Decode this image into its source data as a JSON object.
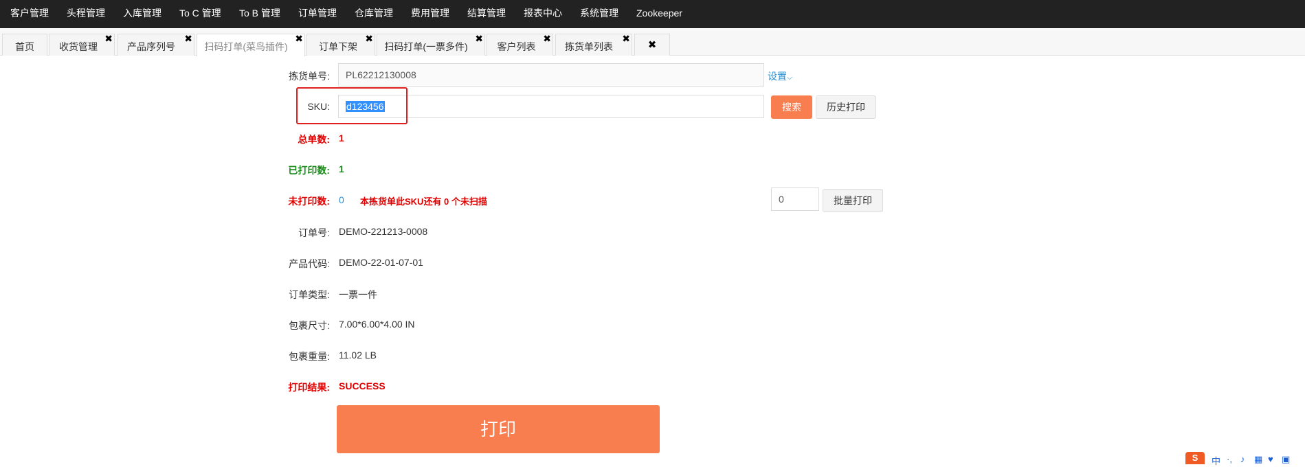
{
  "topnav": {
    "items": [
      "客户管理",
      "头程管理",
      "入库管理",
      "To C 管理",
      "To B 管理",
      "订单管理",
      "仓库管理",
      "费用管理",
      "结算管理",
      "报表中心",
      "系统管理",
      "Zookeeper"
    ]
  },
  "tabs": [
    {
      "label": "首页",
      "closable": false
    },
    {
      "label": "收货管理",
      "closable": true
    },
    {
      "label": "产品序列号",
      "closable": true
    },
    {
      "label": "扫码打单(菜鸟插件)",
      "closable": true,
      "active": true
    },
    {
      "label": "订单下架",
      "closable": true
    },
    {
      "label": "扫码打单(一票多件)",
      "closable": true
    },
    {
      "label": "客户列表",
      "closable": true
    },
    {
      "label": "拣货单列表",
      "closable": true
    }
  ],
  "tab_close_glyph": "✖",
  "form": {
    "picklist_label": "拣货单号:",
    "picklist_value": "PL62212130008",
    "settings_link": "设置",
    "settings_caret": "⌵",
    "sku_label": "SKU:",
    "sku_value": "d123456",
    "search_button": "搜索",
    "history_button": "历史打印",
    "total_label": "总单数:",
    "total_value": "1",
    "printed_label": "已打印数:",
    "printed_value": "1",
    "unprinted_label": "未打印数:",
    "unprinted_value": "0",
    "unprinted_message": "本拣货单此SKU还有 0 个未扫描",
    "batch_qty": "0",
    "batch_print_button": "批量打印",
    "order_no_label": "订单号:",
    "order_no_value": "DEMO-221213-0008",
    "product_code_label": "产品代码:",
    "product_code_value": "DEMO-22-01-07-01",
    "order_type_label": "订单类型:",
    "order_type_value": "一票一件",
    "package_size_label": "包裹尺寸:",
    "package_size_value": "7.00*6.00*4.00 IN",
    "package_weight_label": "包裹重量:",
    "package_weight_value": "11.02 LB",
    "print_result_label": "打印结果:",
    "print_result_value": "SUCCESS",
    "print_button": "打印"
  },
  "ime": {
    "logo": "S",
    "icons": [
      "中",
      "·,",
      "♪",
      "▦",
      "♥",
      "▣"
    ]
  },
  "colors": {
    "nav_bg": "#222222",
    "accent_orange": "#f87e50",
    "highlight_red": "#e0201e",
    "status_red": "#e00000",
    "status_green": "#1a8a1a",
    "link_blue": "#2a8fd6"
  }
}
